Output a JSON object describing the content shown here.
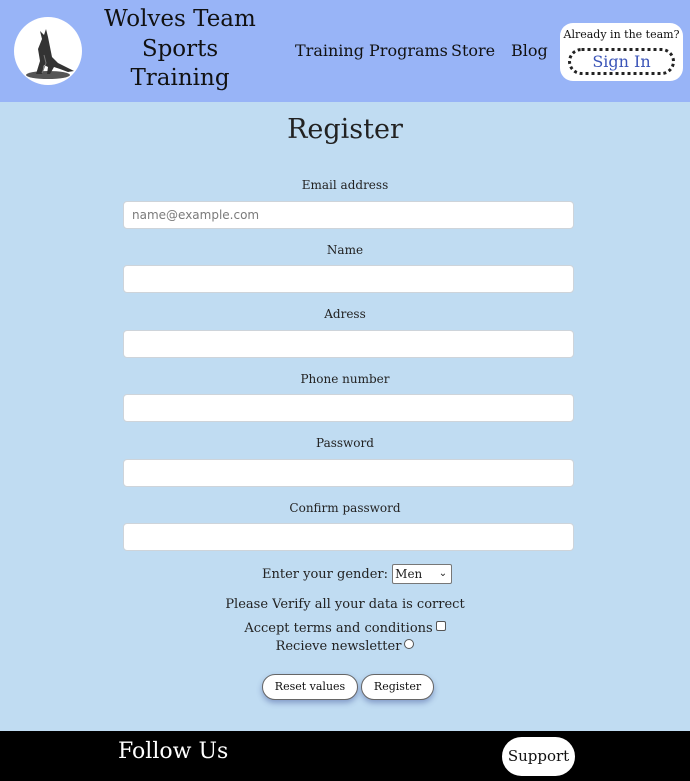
{
  "header": {
    "brand_line1": "Wolves Team",
    "brand_line2": "Sports",
    "brand_line3": "Training",
    "logo_icon": "wolf-icon",
    "nav": {
      "training": "Training Programs",
      "store": "Store",
      "blog": "Blog"
    },
    "signin": {
      "prompt": "Already in the team?",
      "button": "Sign In"
    }
  },
  "form": {
    "title": "Register",
    "fields": [
      {
        "label": "Email address",
        "placeholder": "name@example.com",
        "value": ""
      },
      {
        "label": "Name",
        "placeholder": "",
        "value": ""
      },
      {
        "label": "Adress",
        "placeholder": "",
        "value": ""
      },
      {
        "label": "Phone number",
        "placeholder": "",
        "value": ""
      },
      {
        "label": "Password",
        "placeholder": "",
        "value": ""
      },
      {
        "label": "Confirm password",
        "placeholder": "",
        "value": ""
      }
    ],
    "gender_label": "Enter your gender:",
    "gender_value": "Men",
    "verify_text": "Please Verify all your data is correct",
    "terms_label": "Accept terms and conditions",
    "newsletter_label": "Recieve newsletter",
    "reset_button": "Reset values",
    "register_button": "Register"
  },
  "footer": {
    "follow": "Follow Us",
    "support": "Support"
  },
  "colors": {
    "header_bg": "#98b4f7",
    "page_bg": "#c0dcf2",
    "footer_bg": "#000000",
    "signin_text": "#3b55b8"
  }
}
